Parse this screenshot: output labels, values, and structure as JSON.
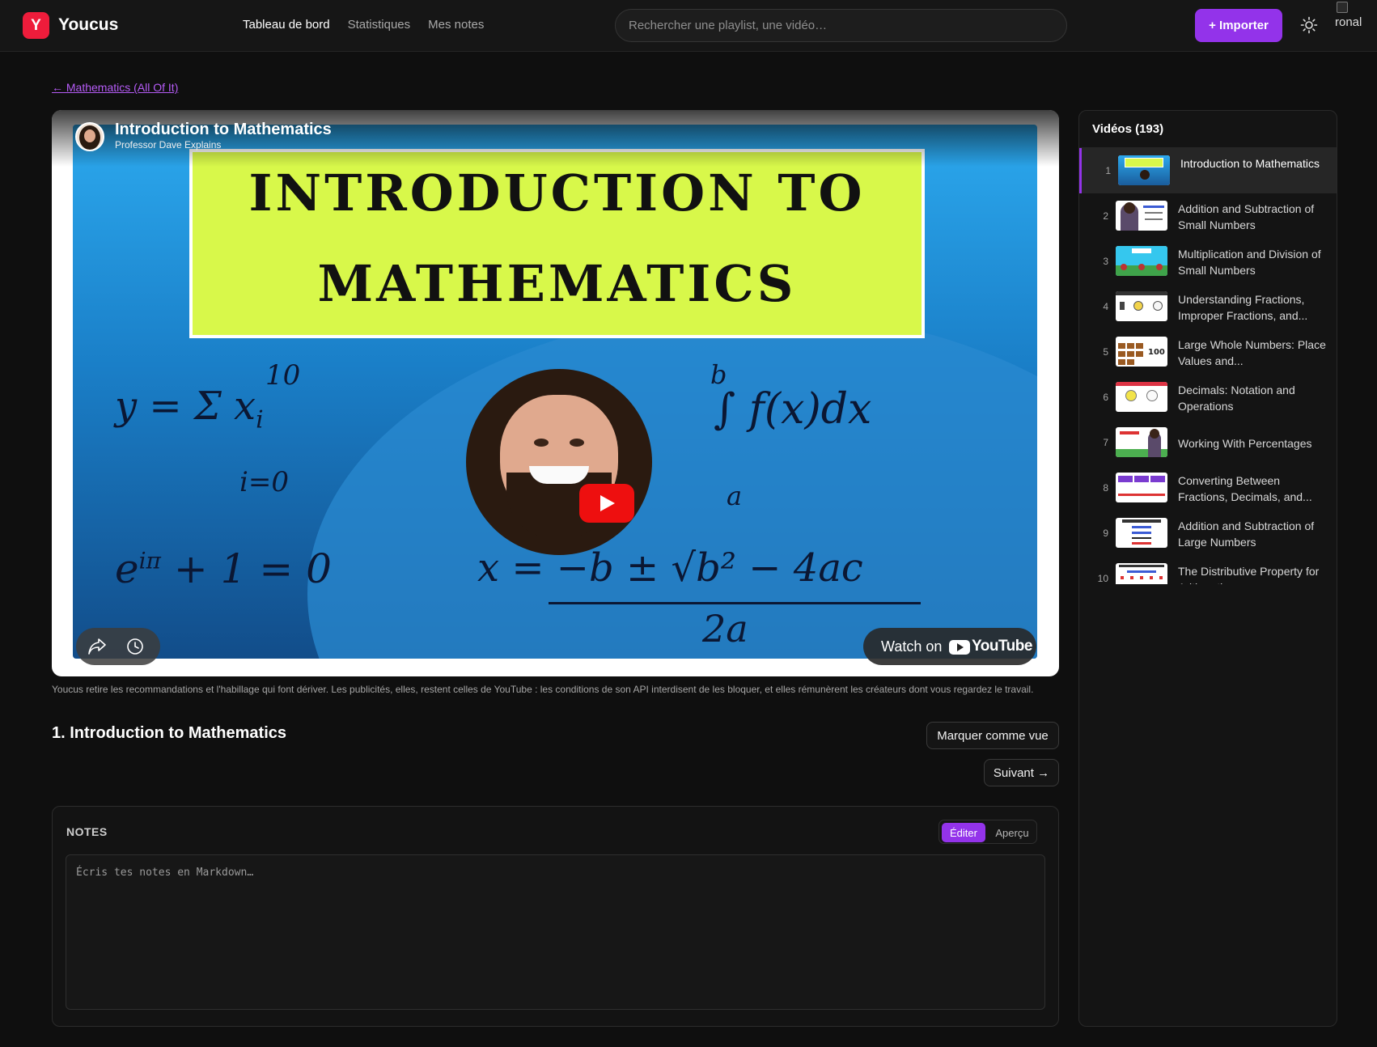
{
  "app": {
    "logo_letter": "Y",
    "name": "Youcus"
  },
  "nav": [
    {
      "label": "Tableau de bord",
      "active": true
    },
    {
      "label": "Statistiques",
      "active": false
    },
    {
      "label": "Mes notes",
      "active": false
    }
  ],
  "search": {
    "placeholder": "Rechercher une playlist, une vidéo…",
    "value": ""
  },
  "header": {
    "import_label": "+ Importer",
    "theme_icon": "sun-icon",
    "avatar_alt": "ronal"
  },
  "breadcrumb": {
    "back_label": "← Mathematics (All Of It)"
  },
  "player": {
    "title": "Introduction to Mathematics",
    "channel": "Professor Dave Explains",
    "thumb_line1": "INTRODUCTION TO",
    "thumb_line2": "MATHEMATICS",
    "watch_on": "Watch on",
    "youtube_word": "YouTube",
    "icons": [
      "share-icon",
      "clock-icon",
      "play-icon"
    ]
  },
  "disclaimer": "Youcus retire les recommandations et l'habillage qui font dériver. Les publicités, elles, restent celles de YouTube : les conditions de son API interdisent de les bloquer, et elles rémunèrent les créateurs dont vous regardez le travail.",
  "lesson": {
    "title": "1. Introduction to Mathematics",
    "mark_seen_label": "Marquer comme vue",
    "next_label": "Suivant →"
  },
  "notes": {
    "heading": "NOTES",
    "tab_edit": "Éditer",
    "tab_preview": "Aperçu",
    "placeholder": "Écris tes notes en Markdown…",
    "value": ""
  },
  "sidebar": {
    "heading": "Vidéos (193)",
    "videos": [
      {
        "num": "1",
        "title": "Introduction to Mathematics",
        "active": true
      },
      {
        "num": "2",
        "title": "Addition and Subtraction of Small Numbers",
        "active": false
      },
      {
        "num": "3",
        "title": "Multiplication and Division of Small Numbers",
        "active": false
      },
      {
        "num": "4",
        "title": "Understanding Fractions, Improper Fractions, and...",
        "active": false
      },
      {
        "num": "5",
        "title": "Large Whole Numbers: Place Values and...",
        "active": false
      },
      {
        "num": "6",
        "title": "Decimals: Notation and Operations",
        "active": false
      },
      {
        "num": "7",
        "title": "Working With Percentages",
        "active": false
      },
      {
        "num": "8",
        "title": "Converting Between Fractions, Decimals, and...",
        "active": false
      },
      {
        "num": "9",
        "title": "Addition and Subtraction of Large Numbers",
        "active": false
      },
      {
        "num": "10",
        "title": "The Distributive Property for Arithmetic",
        "active": false
      }
    ]
  },
  "colors": {
    "accent": "#9333ea",
    "logo": "#ee1c3b",
    "background": "#0f0f0f"
  }
}
